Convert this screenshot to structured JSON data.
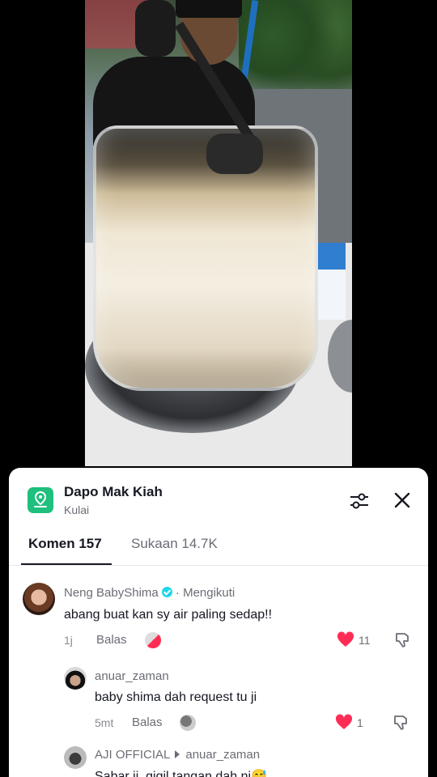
{
  "header": {
    "location_title": "Dapo Mak Kiah",
    "location_subtitle": "Kulai"
  },
  "tabs": [
    {
      "label": "Komen 157",
      "active": true
    },
    {
      "label": "Sukaan 14.7K",
      "active": false
    }
  ],
  "comments": [
    {
      "username": "Neng BabyShima",
      "verified": true,
      "follow_label": "· Mengikuti",
      "text": "abang buat kan sy air paling sedap!!",
      "time": "1j",
      "reply_label": "Balas",
      "likes": "11",
      "liked": true
    },
    {
      "username": "anuar_zaman",
      "text": "baby shima dah request tu ji",
      "time": "5mt",
      "reply_label": "Balas",
      "likes": "1",
      "liked": true
    },
    {
      "username": "AJI OFFICIAL",
      "reply_to": "anuar_zaman",
      "text": "Sabar ji, gigil tangan dah ni😅"
    }
  ],
  "colors": {
    "accent_heart": "#fe2c55",
    "location_icon": "#1fbf7e",
    "verified": "#20d5ec"
  },
  "icons": [
    "location-pin-icon",
    "filter-sliders-icon",
    "close-icon",
    "heart-icon",
    "dislike-icon",
    "verified-icon"
  ]
}
